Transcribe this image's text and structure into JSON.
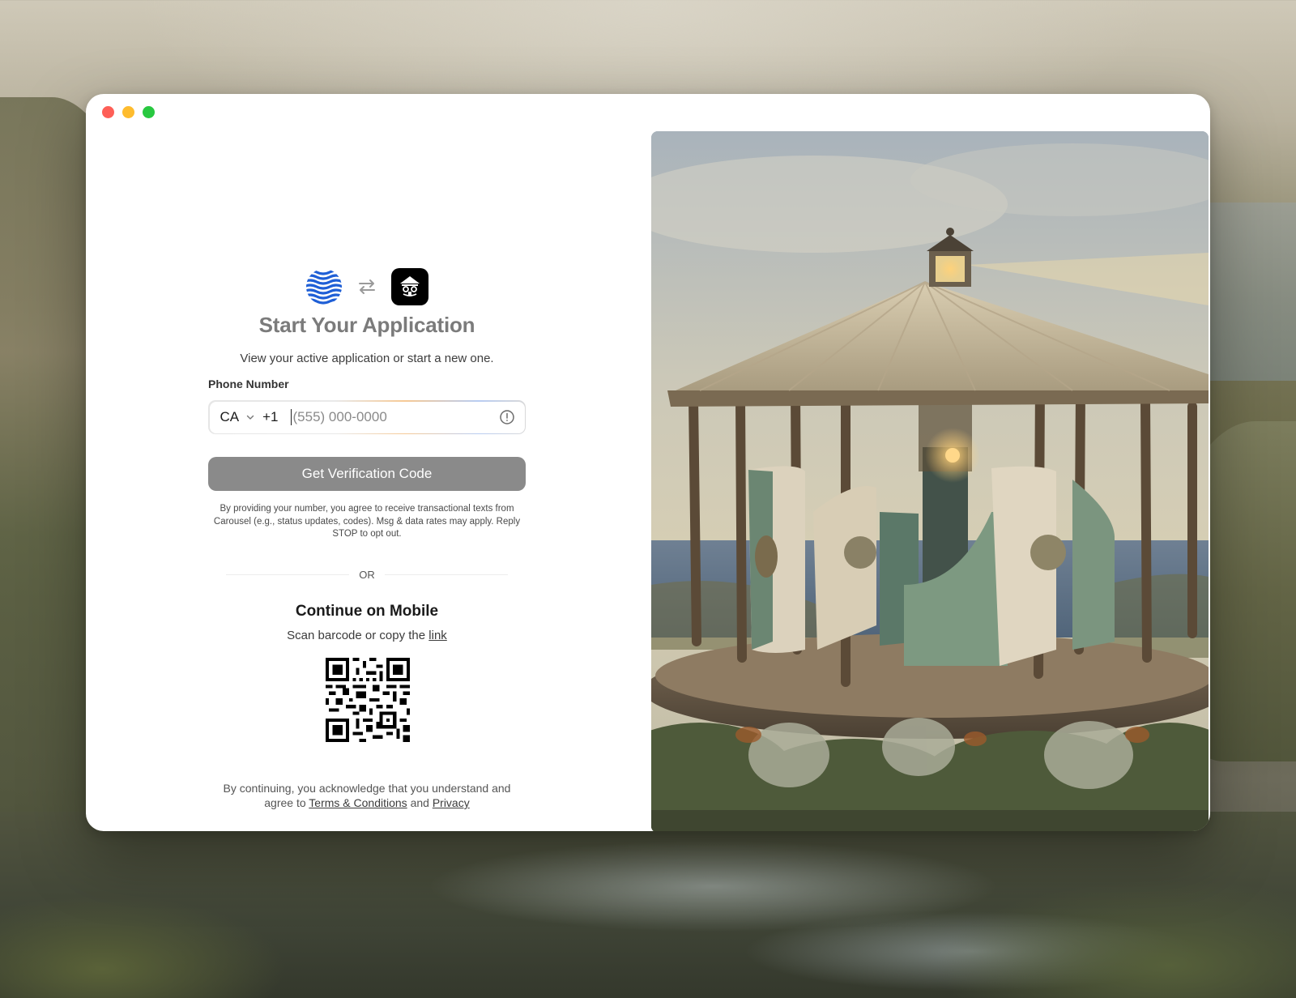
{
  "window": {
    "controls": [
      "close",
      "minimize",
      "zoom"
    ]
  },
  "header": {
    "logo_left": "wave-logo-icon",
    "swap": "swap-arrows-icon",
    "logo_right": "carousel-app-icon",
    "title": "Start Your Application",
    "subtitle": "View your active application or start a new one."
  },
  "phone": {
    "label": "Phone Number",
    "country": "CA",
    "dial_code": "+1",
    "placeholder": "(555) 000-0000",
    "value": ""
  },
  "verify_button": "Get Verification Code",
  "disclaimer": "By providing your number, you agree to receive transactional texts from Carousel (e.g., status updates, codes). Msg & data rates may apply. Reply STOP to opt out.",
  "divider": "OR",
  "mobile": {
    "title": "Continue on Mobile",
    "subtitle_prefix": "Scan barcode or copy the",
    "link": "link"
  },
  "legal": {
    "line1": "By continuing, you acknowledge that you understand and",
    "prefix": "agree to",
    "terms": "Terms & Conditions",
    "and": "and",
    "privacy": "Privacy"
  },
  "colors": {
    "button_disabled": "#8a8a8a",
    "wave_logo": "#1f5fd6",
    "traffic_red": "#fe5f57",
    "traffic_yellow": "#febc2e",
    "traffic_green": "#28c840"
  }
}
